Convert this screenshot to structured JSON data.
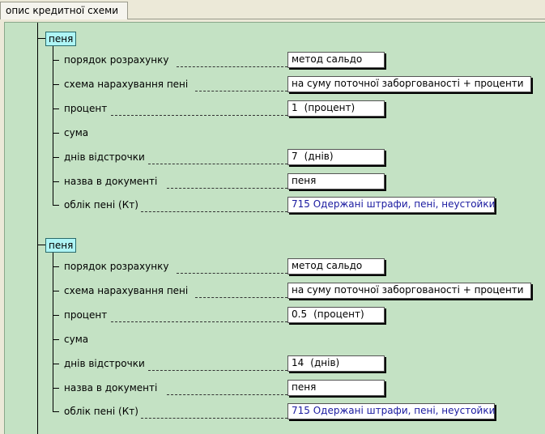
{
  "tab": {
    "label": "опис кредитної схеми"
  },
  "groups": [
    {
      "title": "пеня",
      "rows": [
        {
          "label": "порядок розрахунку",
          "value": "метод сальдо"
        },
        {
          "label": "схема нарахування пені",
          "value": "на суму поточної заборгованості + проценти"
        },
        {
          "label": "процент",
          "value": "1",
          "unit": "(процент)"
        },
        {
          "label": "сума"
        },
        {
          "label": "днів відстрочки",
          "value": "7",
          "unit": "(днів)"
        },
        {
          "label": "назва в документі",
          "value": "пеня"
        },
        {
          "label": "облік пені (Кт)",
          "value": "715 Одержані штрафи, пені, неустойки"
        }
      ]
    },
    {
      "title": "пеня",
      "rows": [
        {
          "label": "порядок розрахунку",
          "value": "метод сальдо"
        },
        {
          "label": "схема нарахування пені",
          "value": "на суму поточної заборгованості + проценти"
        },
        {
          "label": "процент",
          "value": "0.5",
          "unit": "(процент)"
        },
        {
          "label": "сума"
        },
        {
          "label": "днів відстрочки",
          "value": "14",
          "unit": "(днів)"
        },
        {
          "label": "назва в документі",
          "value": "пеня"
        },
        {
          "label": "облік пені (Кт)",
          "value": "715 Одержані штрафи, пені, неустойки"
        }
      ]
    }
  ]
}
